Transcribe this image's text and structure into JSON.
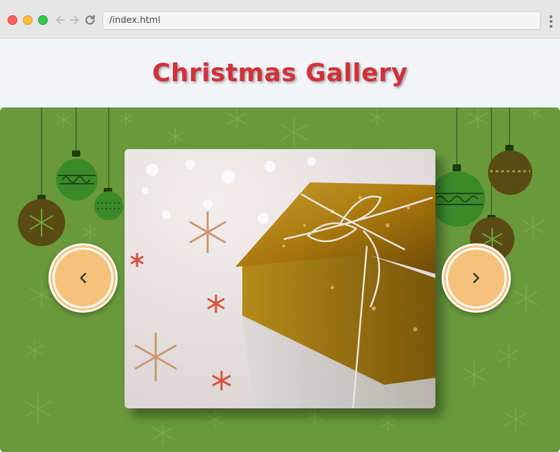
{
  "browser": {
    "url": "/index.html"
  },
  "page": {
    "title": "Christmas Gallery"
  },
  "gallery": {
    "current_image": "gift-box-photo",
    "prev_icon": "chevron-left-icon",
    "next_icon": "chevron-right-icon"
  },
  "colors": {
    "title": "#d2303a",
    "stage_background": "#6a993c",
    "arrow_fill": "#f6c27b",
    "ornament_green": "#3a8a2a",
    "ornament_brown": "#5a4a14"
  }
}
